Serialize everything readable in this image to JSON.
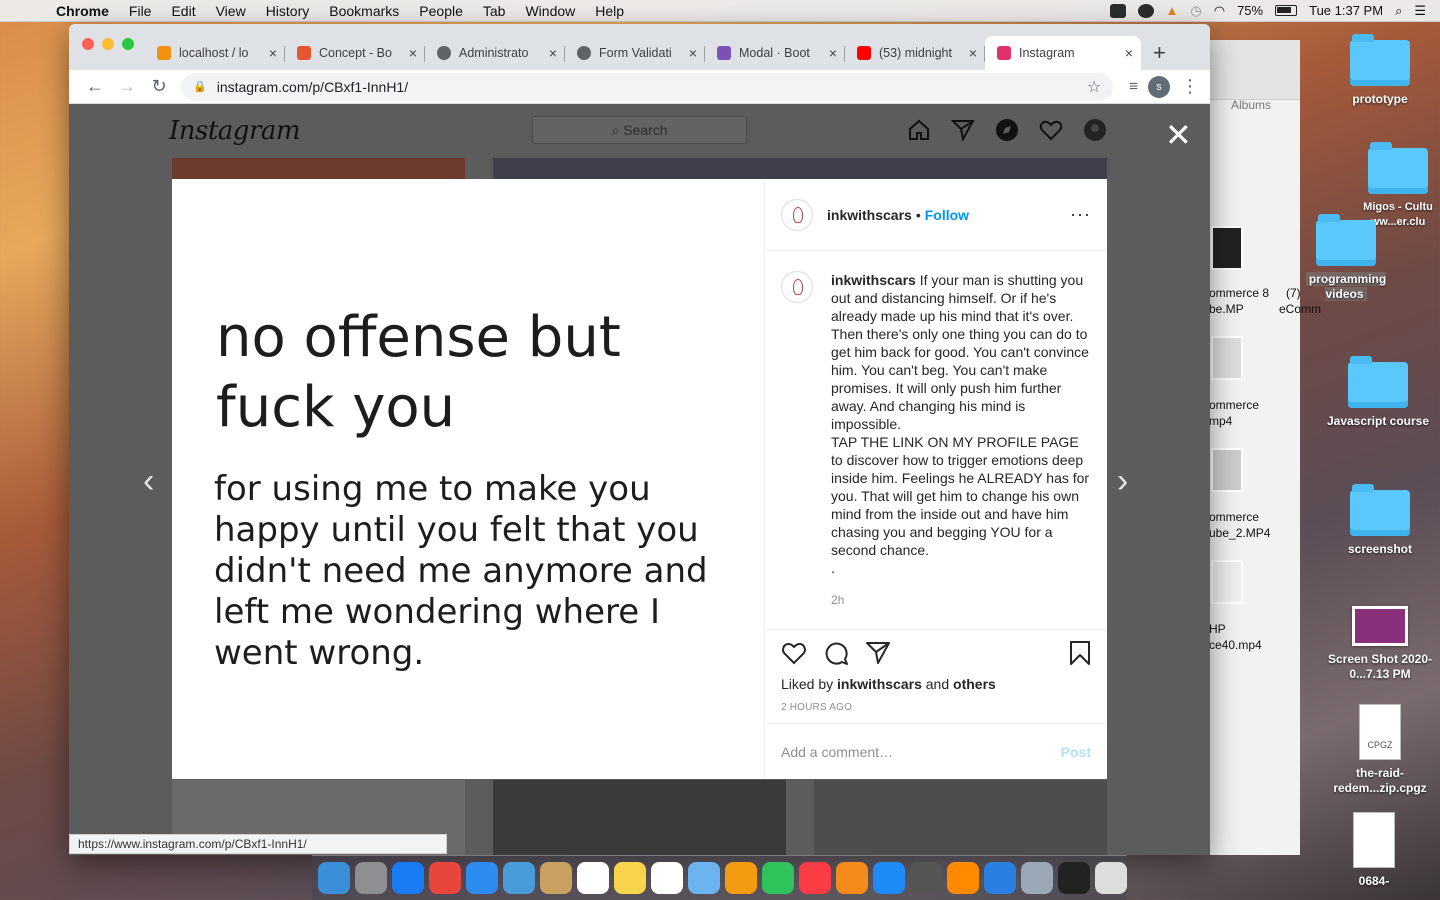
{
  "menubar": {
    "app": "Chrome",
    "items": [
      "File",
      "Edit",
      "View",
      "History",
      "Bookmarks",
      "People",
      "Tab",
      "Window",
      "Help"
    ],
    "battery": "75%",
    "clock": "Tue 1:37 PM"
  },
  "tabs": [
    {
      "title": "localhost / lo",
      "favicon_color": "#f29111"
    },
    {
      "title": "Concept - Bo",
      "favicon_color": "#e4572e"
    },
    {
      "title": "Administrato",
      "favicon_color": "#5f6368"
    },
    {
      "title": "Form Validati",
      "favicon_color": "#5f6368"
    },
    {
      "title": "Modal · Boot",
      "favicon_color": "#7952b3"
    },
    {
      "title": "(53) midnight",
      "favicon_color": "#ff0000"
    },
    {
      "title": "Instagram",
      "favicon_color": "#e1306c"
    }
  ],
  "address": {
    "url": "instagram.com/p/CBxf1-InnH1/"
  },
  "profile_initial": "s",
  "instagram": {
    "logo": "Instagram",
    "search_placeholder": "Search",
    "post": {
      "headline": "no offense but fuck you",
      "body": "for using me to make you happy until you felt that you didn't need me anymore and left me wondering where I went wrong.",
      "username": "inkwithscars",
      "follow": "Follow",
      "caption": "If your man is shutting you out and distancing himself. Or if he's already made up his mind that it's over. Then there's only one thing you can do to get him back for good. You can't convince him. You can't beg. You can't make promises. It will only push him further away. And changing his mind is impossible.\nTAP THE LINK ON MY PROFILE PAGE to discover how to trigger emotions deep inside him. Feelings he ALREADY has for you. That will get him to change his own mind from the inside out and have him chasing you and begging YOU for a second chance.\n.",
      "time": "2h",
      "liked_by_prefix": "Liked by",
      "liked_by_user": "inkwithscars",
      "liked_by_and": "and",
      "liked_by_others": "others",
      "ago": "2 HOURS AGO",
      "comment_placeholder": "Add a comment…",
      "post_button": "Post"
    }
  },
  "status_url": "https://www.instagram.com/p/CBxf1-InnH1/",
  "finder": {
    "albums": "Albums",
    "files": [
      "ommerce 8",
      "be.MP",
      "(7)",
      "eComm",
      "ommerce",
      "mp4",
      "ommerce",
      "ube_2.MP4",
      "HP",
      "ce40.mp4"
    ]
  },
  "desktop": [
    {
      "label": "prototype",
      "kind": "folder"
    },
    {
      "label": "Migos - Cultu ww...er.clu",
      "kind": "folder"
    },
    {
      "label": "programming videos",
      "kind": "folder"
    },
    {
      "label": "Javascript course",
      "kind": "folder"
    },
    {
      "label": "screenshot",
      "kind": "folder"
    },
    {
      "label": "Screen Shot 2020-0...7.13 PM",
      "kind": "image"
    },
    {
      "label": "the-raid-redem...zip.cpgz",
      "kind": "archive",
      "badge": "CPGZ"
    },
    {
      "label": "0684-",
      "kind": "document"
    }
  ],
  "dock_colors": [
    "#3b8fd9",
    "#8e8e93",
    "#1a7cf5",
    "#e8453c",
    "#2d8cf0",
    "#4a9bd9",
    "#c8a060",
    "#ffffff",
    "#f7d44a",
    "#ffffff",
    "#6cb4ef",
    "#f39c12",
    "#30c35b",
    "#fc3c44",
    "#f48c1c",
    "#1d8cf8",
    "#555555",
    "#ff8a00",
    "#2b7fe0",
    "#9aa8b8",
    "#222222",
    "#dddddd"
  ]
}
